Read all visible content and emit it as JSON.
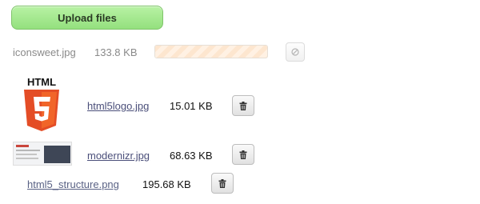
{
  "upload_button": {
    "label": "Upload files"
  },
  "files": [
    {
      "name": "iconsweet.jpg",
      "size": "133.8 KB",
      "state": "uploading",
      "progress_fraction": 1.0,
      "action_icon": "cancel-icon"
    },
    {
      "name": "html5logo.jpg",
      "size": "15.01 KB",
      "state": "uploaded",
      "thumbnail_text": "HTML",
      "thumbnail_numeral": "5",
      "action_icon": "trash-icon"
    },
    {
      "name": "modernizr.jpg",
      "size": "68.63 KB",
      "state": "uploaded",
      "thumbnail_icon": "screenshot-thumbnail",
      "action_icon": "trash-icon"
    },
    {
      "name": "html5_structure.png",
      "size": "195.68 KB",
      "state": "uploaded",
      "action_icon": "trash-icon"
    }
  ],
  "colors": {
    "upload_button_bg": "#a8ec92",
    "progress_fill": "#fde6cf",
    "html5_orange": "#e44d26",
    "link": "#4b4f7a"
  }
}
